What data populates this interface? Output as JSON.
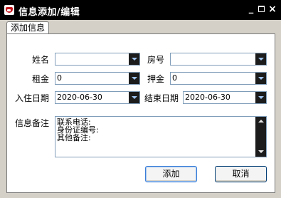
{
  "window": {
    "title": "信息添加/编辑",
    "controls": {
      "minimize": "_",
      "close": "×"
    }
  },
  "tabs": [
    {
      "label": "添加信息",
      "selected": true
    }
  ],
  "form": {
    "name": {
      "label": "姓名",
      "value": ""
    },
    "room": {
      "label": "房号",
      "value": ""
    },
    "rent": {
      "label": "租金",
      "value": "0"
    },
    "deposit": {
      "label": "押金",
      "value": "0"
    },
    "checkin": {
      "label": "入住日期",
      "value": "2020-06-30"
    },
    "checkout": {
      "label": "结束日期",
      "value": "2020-06-30"
    },
    "notes": {
      "label": "信息备注",
      "lines": [
        "联系电话:",
        "身份证编号:",
        "其他备注:"
      ]
    }
  },
  "buttons": {
    "ok": "添加",
    "cancel": "取消"
  },
  "colors": {
    "titlebar": "#000000",
    "dialog": "#d4d0c8",
    "field_border": "#7f9db9",
    "dropdown_button": "#1c1c1c",
    "dropdown_arrow": "#9ec3ee"
  }
}
